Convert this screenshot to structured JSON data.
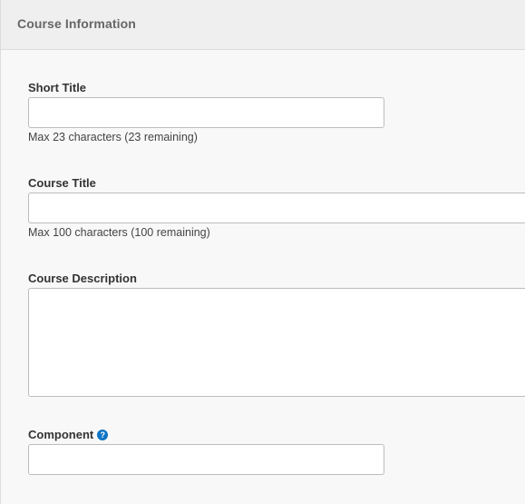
{
  "header": {
    "title": "Course Information"
  },
  "fields": {
    "short_title": {
      "label": "Short Title",
      "value": "",
      "help": "Max 23 characters (23 remaining)"
    },
    "course_title": {
      "label": "Course Title",
      "value": "",
      "help": "Max 100 characters (100 remaining)"
    },
    "course_description": {
      "label": "Course Description",
      "value": ""
    },
    "component": {
      "label": "Component",
      "value": "",
      "help_icon_glyph": "?"
    }
  },
  "icons": {
    "component_help": "question-circle-icon"
  },
  "colors": {
    "accent": "#0f74c4",
    "header_bg": "#efefef",
    "page_bg": "#f8f8f8"
  }
}
